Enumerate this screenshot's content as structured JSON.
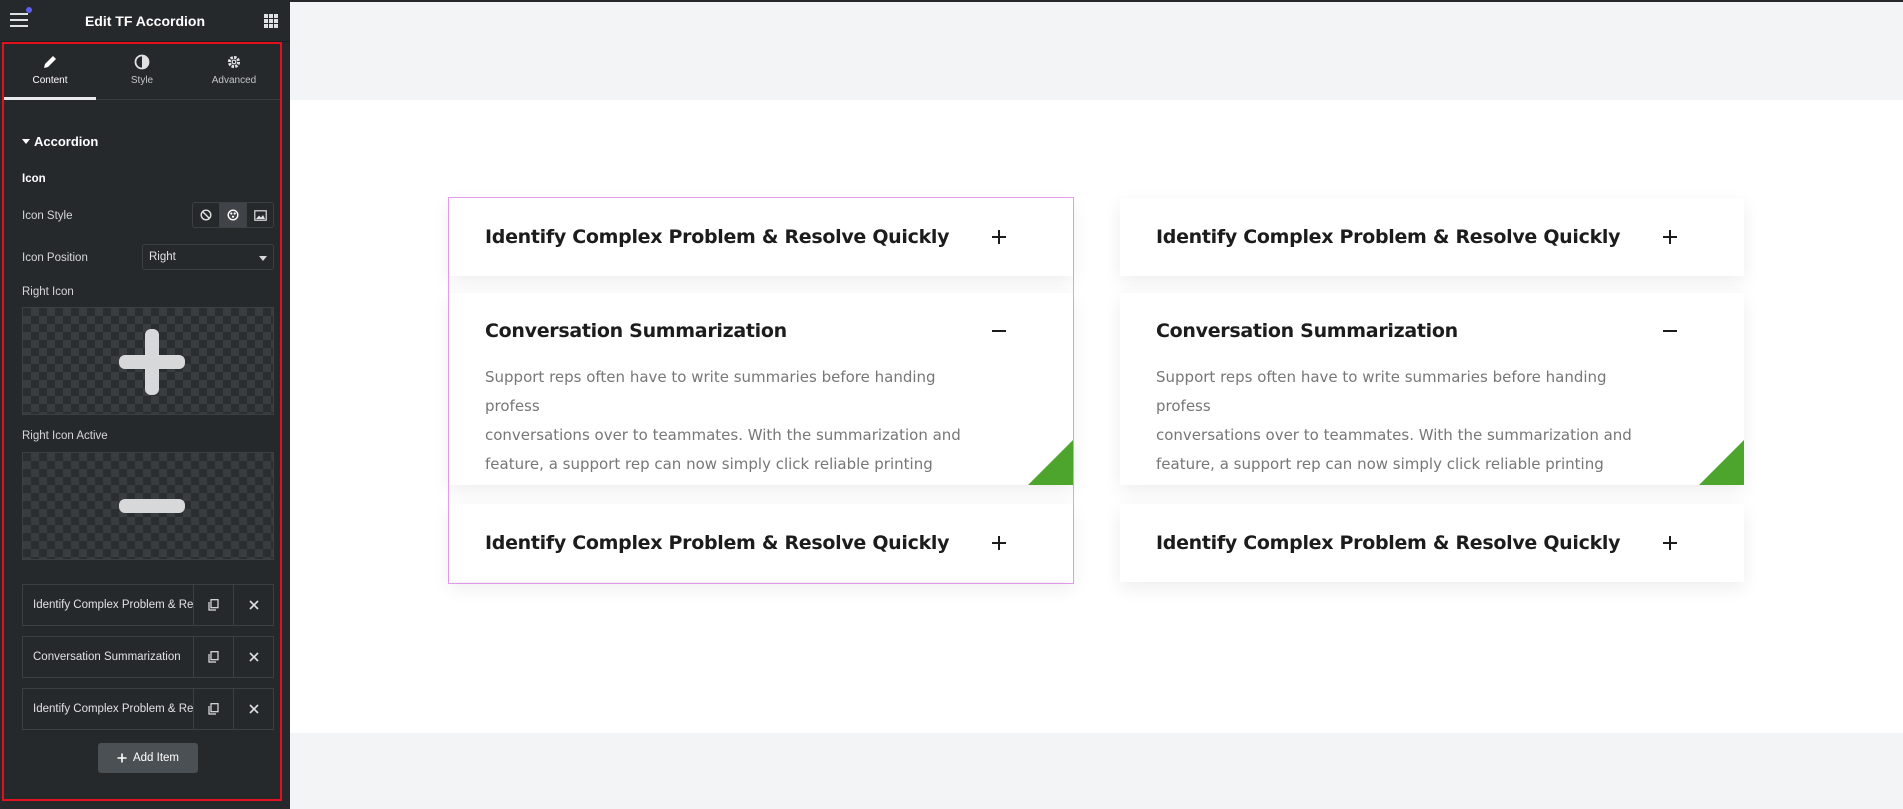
{
  "panel": {
    "title": "Edit TF Accordion",
    "tabs": [
      {
        "label": "Content",
        "icon": "pencil-icon",
        "active": true
      },
      {
        "label": "Style",
        "icon": "half-circle-icon",
        "active": false
      },
      {
        "label": "Advanced",
        "icon": "gear-icon",
        "active": false
      }
    ],
    "section": "Accordion",
    "icon_heading": "Icon",
    "icon_style_label": "Icon Style",
    "icon_style_options": [
      "none-icon",
      "library-icon",
      "image-icon"
    ],
    "icon_position_label": "Icon Position",
    "icon_position_value": "Right",
    "right_icon_label": "Right Icon",
    "right_icon_active_label": "Right Icon Active",
    "items": [
      {
        "title": "Identify Complex Problem & Resolve Quickly"
      },
      {
        "title": "Conversation Summarization"
      },
      {
        "title": "Identify Complex Problem & Resolve Quickly"
      }
    ],
    "add_item_label": "Add Item"
  },
  "accordions": {
    "left": {
      "items": [
        {
          "title": "Identify Complex Problem & Resolve Quickly"
        },
        {
          "title": "Conversation Summarization",
          "body": [
            "Support reps often have to write summaries before handing profess",
            "conversations over to teammates. With the summarization and",
            "feature, a support rep can now simply click reliable printing"
          ]
        },
        {
          "title": "Identify Complex Problem & Resolve Quickly"
        }
      ]
    },
    "right": {
      "items": [
        {
          "title": "Identify Complex Problem & Resolve Quickly"
        },
        {
          "title": "Conversation Summarization",
          "body": [
            "Support reps often have to write summaries before handing profess",
            "conversations over to teammates. With the summarization and",
            "feature, a support rep can now simply click reliable printing"
          ]
        },
        {
          "title": "Identify Complex Problem & Resolve Quickly"
        }
      ]
    }
  },
  "colors": {
    "panel_bg": "#26292c",
    "accent_green": "#4ea52e",
    "selection_outline": "#ea9ef0",
    "panel_border": "#e3101f"
  }
}
